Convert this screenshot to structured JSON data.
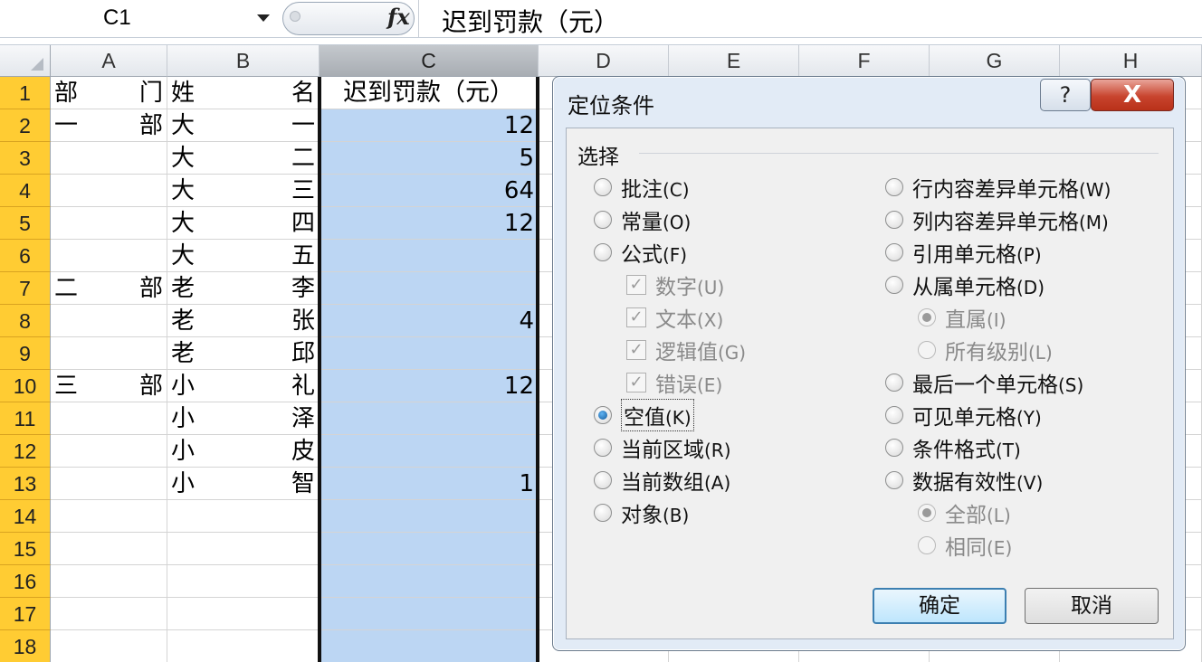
{
  "formula_bar": {
    "name_box": "C1",
    "fx_icon": "fx-icon",
    "formula": "迟到罚款（元）"
  },
  "columns": [
    "A",
    "B",
    "C",
    "D",
    "E",
    "F",
    "G",
    "H"
  ],
  "rows": [
    "1",
    "2",
    "3",
    "4",
    "5",
    "6",
    "7",
    "8",
    "9",
    "10",
    "11",
    "12",
    "13",
    "14",
    "15",
    "16",
    "17",
    "18"
  ],
  "cells": {
    "a": [
      [
        "部",
        "门"
      ],
      [
        "一",
        "部"
      ],
      [
        "",
        ""
      ],
      [
        "",
        ""
      ],
      [
        "",
        ""
      ],
      [
        "",
        ""
      ],
      [
        "二",
        "部"
      ],
      [
        "",
        ""
      ],
      [
        "",
        ""
      ],
      [
        "三",
        "部"
      ],
      [
        "",
        ""
      ],
      [
        "",
        ""
      ],
      [
        "",
        ""
      ]
    ],
    "b": [
      [
        "姓",
        "名"
      ],
      [
        "大",
        "一"
      ],
      [
        "大",
        "二"
      ],
      [
        "大",
        "三"
      ],
      [
        "大",
        "四"
      ],
      [
        "大",
        "五"
      ],
      [
        "老",
        "李"
      ],
      [
        "老",
        "张"
      ],
      [
        "老",
        "邱"
      ],
      [
        "小",
        "礼"
      ],
      [
        "小",
        "泽"
      ],
      [
        "小",
        "皮"
      ],
      [
        "小",
        "智"
      ]
    ],
    "c": [
      "迟到罚款（元）",
      "12",
      "5",
      "64",
      "12",
      "",
      "",
      "4",
      "",
      "12",
      "",
      "",
      "1"
    ]
  },
  "selected_column": "C",
  "selection_color": "#bcd6f3",
  "row_header_color": "#ffcc33",
  "dialog": {
    "title": "定位条件",
    "help": "?",
    "close": "X",
    "group": "选择",
    "left_options": [
      {
        "label": "批注",
        "key": "(C)",
        "kind": "radio",
        "state": "off"
      },
      {
        "label": "常量",
        "key": "(O)",
        "kind": "radio",
        "state": "off"
      },
      {
        "label": "公式",
        "key": "(F)",
        "kind": "radio",
        "state": "off"
      },
      {
        "label": "数字",
        "key": "(U)",
        "kind": "check",
        "state": "disabled-checked"
      },
      {
        "label": "文本",
        "key": "(X)",
        "kind": "check",
        "state": "disabled-checked"
      },
      {
        "label": "逻辑值",
        "key": "(G)",
        "kind": "check",
        "state": "disabled-checked"
      },
      {
        "label": "错误",
        "key": "(E)",
        "kind": "check",
        "state": "disabled-checked"
      },
      {
        "label": "空值",
        "key": "(K)",
        "kind": "radio",
        "state": "on"
      },
      {
        "label": "当前区域",
        "key": "(R)",
        "kind": "radio",
        "state": "off"
      },
      {
        "label": "当前数组",
        "key": "(A)",
        "kind": "radio",
        "state": "off"
      },
      {
        "label": "对象",
        "key": "(B)",
        "kind": "radio",
        "state": "off"
      }
    ],
    "right_options": [
      {
        "label": "行内容差异单元格",
        "key": "(W)",
        "kind": "radio",
        "state": "off"
      },
      {
        "label": "列内容差异单元格",
        "key": "(M)",
        "kind": "radio",
        "state": "off"
      },
      {
        "label": "引用单元格",
        "key": "(P)",
        "kind": "radio",
        "state": "off"
      },
      {
        "label": "从属单元格",
        "key": "(D)",
        "kind": "radio",
        "state": "off"
      },
      {
        "label": "直属",
        "key": "(I)",
        "kind": "radio",
        "state": "disabled-on"
      },
      {
        "label": "所有级别",
        "key": "(L)",
        "kind": "radio",
        "state": "disabled"
      },
      {
        "label": "最后一个单元格",
        "key": "(S)",
        "kind": "radio",
        "state": "off"
      },
      {
        "label": "可见单元格",
        "key": "(Y)",
        "kind": "radio",
        "state": "off"
      },
      {
        "label": "条件格式",
        "key": "(T)",
        "kind": "radio",
        "state": "off"
      },
      {
        "label": "数据有效性",
        "key": "(V)",
        "kind": "radio",
        "state": "off"
      },
      {
        "label": "全部",
        "key": "(L)",
        "kind": "radio",
        "state": "disabled-on"
      },
      {
        "label": "相同",
        "key": "(E)",
        "kind": "radio",
        "state": "disabled"
      }
    ],
    "ok": "确定",
    "cancel": "取消"
  }
}
